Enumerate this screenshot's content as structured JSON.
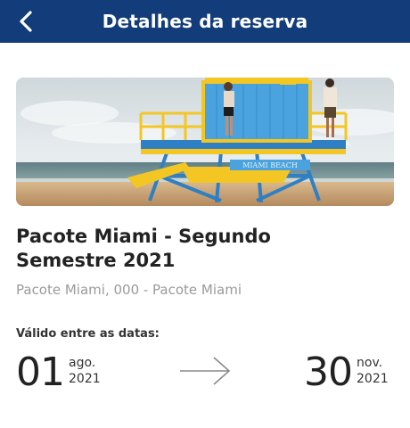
{
  "header": {
    "title": "Detalhes da reserva",
    "back_icon": "chevron-left-icon",
    "background": "#123d7a"
  },
  "hero": {
    "sign_text": "MIAMI BEACH"
  },
  "package": {
    "title_line1": "Pacote Miami - Segundo",
    "title_line2": "Semestre 2021",
    "subtitle": "Pacote Miami, 000 - Pacote Miami"
  },
  "validity": {
    "label": "Válido entre as datas:",
    "start": {
      "day": "01",
      "month": "ago.",
      "year": "2021"
    },
    "end": {
      "day": "30",
      "month": "nov.",
      "year": "2021"
    },
    "arrow_icon": "arrow-right-icon"
  }
}
